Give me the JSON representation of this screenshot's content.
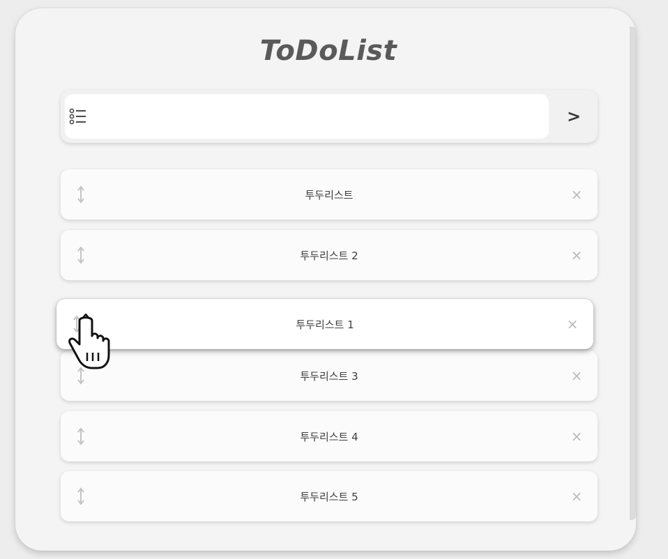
{
  "app": {
    "title": "ToDoList"
  },
  "input": {
    "value": "",
    "placeholder": "",
    "submit_label": ">",
    "icon": "list-icon"
  },
  "items": [
    {
      "label": "투두리스트"
    },
    {
      "label": "투두리스트 2"
    },
    {
      "label": "투두리스트 1",
      "state": "dragging"
    },
    {
      "label": "투두리스트 3"
    },
    {
      "label": "투두리스트 4"
    },
    {
      "label": "투두리스트 5"
    }
  ],
  "item_controls": {
    "drag_icon": "drag-handle-icon",
    "delete_label": "×"
  },
  "colors": {
    "background": "#ededed",
    "card": "#f4f4f4",
    "title": "#5a5a5a",
    "delete": "#b9b9b9",
    "handle": "#c4c4c4"
  }
}
